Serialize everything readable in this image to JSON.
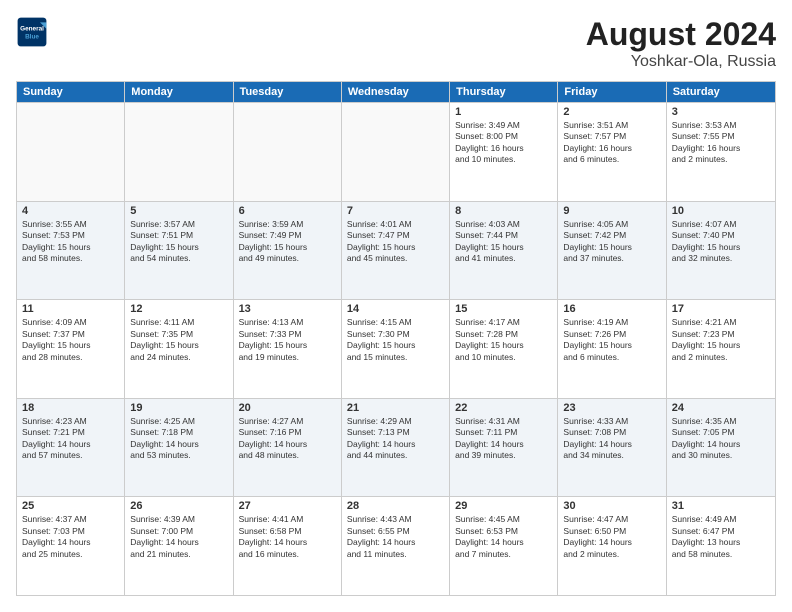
{
  "logo": {
    "line1": "General",
    "line2": "Blue"
  },
  "title": "August 2024",
  "subtitle": "Yoshkar-Ola, Russia",
  "header_days": [
    "Sunday",
    "Monday",
    "Tuesday",
    "Wednesday",
    "Thursday",
    "Friday",
    "Saturday"
  ],
  "rows": [
    [
      {
        "day": "",
        "info": ""
      },
      {
        "day": "",
        "info": ""
      },
      {
        "day": "",
        "info": ""
      },
      {
        "day": "",
        "info": ""
      },
      {
        "day": "1",
        "info": "Sunrise: 3:49 AM\nSunset: 8:00 PM\nDaylight: 16 hours\nand 10 minutes."
      },
      {
        "day": "2",
        "info": "Sunrise: 3:51 AM\nSunset: 7:57 PM\nDaylight: 16 hours\nand 6 minutes."
      },
      {
        "day": "3",
        "info": "Sunrise: 3:53 AM\nSunset: 7:55 PM\nDaylight: 16 hours\nand 2 minutes."
      }
    ],
    [
      {
        "day": "4",
        "info": "Sunrise: 3:55 AM\nSunset: 7:53 PM\nDaylight: 15 hours\nand 58 minutes."
      },
      {
        "day": "5",
        "info": "Sunrise: 3:57 AM\nSunset: 7:51 PM\nDaylight: 15 hours\nand 54 minutes."
      },
      {
        "day": "6",
        "info": "Sunrise: 3:59 AM\nSunset: 7:49 PM\nDaylight: 15 hours\nand 49 minutes."
      },
      {
        "day": "7",
        "info": "Sunrise: 4:01 AM\nSunset: 7:47 PM\nDaylight: 15 hours\nand 45 minutes."
      },
      {
        "day": "8",
        "info": "Sunrise: 4:03 AM\nSunset: 7:44 PM\nDaylight: 15 hours\nand 41 minutes."
      },
      {
        "day": "9",
        "info": "Sunrise: 4:05 AM\nSunset: 7:42 PM\nDaylight: 15 hours\nand 37 minutes."
      },
      {
        "day": "10",
        "info": "Sunrise: 4:07 AM\nSunset: 7:40 PM\nDaylight: 15 hours\nand 32 minutes."
      }
    ],
    [
      {
        "day": "11",
        "info": "Sunrise: 4:09 AM\nSunset: 7:37 PM\nDaylight: 15 hours\nand 28 minutes."
      },
      {
        "day": "12",
        "info": "Sunrise: 4:11 AM\nSunset: 7:35 PM\nDaylight: 15 hours\nand 24 minutes."
      },
      {
        "day": "13",
        "info": "Sunrise: 4:13 AM\nSunset: 7:33 PM\nDaylight: 15 hours\nand 19 minutes."
      },
      {
        "day": "14",
        "info": "Sunrise: 4:15 AM\nSunset: 7:30 PM\nDaylight: 15 hours\nand 15 minutes."
      },
      {
        "day": "15",
        "info": "Sunrise: 4:17 AM\nSunset: 7:28 PM\nDaylight: 15 hours\nand 10 minutes."
      },
      {
        "day": "16",
        "info": "Sunrise: 4:19 AM\nSunset: 7:26 PM\nDaylight: 15 hours\nand 6 minutes."
      },
      {
        "day": "17",
        "info": "Sunrise: 4:21 AM\nSunset: 7:23 PM\nDaylight: 15 hours\nand 2 minutes."
      }
    ],
    [
      {
        "day": "18",
        "info": "Sunrise: 4:23 AM\nSunset: 7:21 PM\nDaylight: 14 hours\nand 57 minutes."
      },
      {
        "day": "19",
        "info": "Sunrise: 4:25 AM\nSunset: 7:18 PM\nDaylight: 14 hours\nand 53 minutes."
      },
      {
        "day": "20",
        "info": "Sunrise: 4:27 AM\nSunset: 7:16 PM\nDaylight: 14 hours\nand 48 minutes."
      },
      {
        "day": "21",
        "info": "Sunrise: 4:29 AM\nSunset: 7:13 PM\nDaylight: 14 hours\nand 44 minutes."
      },
      {
        "day": "22",
        "info": "Sunrise: 4:31 AM\nSunset: 7:11 PM\nDaylight: 14 hours\nand 39 minutes."
      },
      {
        "day": "23",
        "info": "Sunrise: 4:33 AM\nSunset: 7:08 PM\nDaylight: 14 hours\nand 34 minutes."
      },
      {
        "day": "24",
        "info": "Sunrise: 4:35 AM\nSunset: 7:05 PM\nDaylight: 14 hours\nand 30 minutes."
      }
    ],
    [
      {
        "day": "25",
        "info": "Sunrise: 4:37 AM\nSunset: 7:03 PM\nDaylight: 14 hours\nand 25 minutes."
      },
      {
        "day": "26",
        "info": "Sunrise: 4:39 AM\nSunset: 7:00 PM\nDaylight: 14 hours\nand 21 minutes."
      },
      {
        "day": "27",
        "info": "Sunrise: 4:41 AM\nSunset: 6:58 PM\nDaylight: 14 hours\nand 16 minutes."
      },
      {
        "day": "28",
        "info": "Sunrise: 4:43 AM\nSunset: 6:55 PM\nDaylight: 14 hours\nand 11 minutes."
      },
      {
        "day": "29",
        "info": "Sunrise: 4:45 AM\nSunset: 6:53 PM\nDaylight: 14 hours\nand 7 minutes."
      },
      {
        "day": "30",
        "info": "Sunrise: 4:47 AM\nSunset: 6:50 PM\nDaylight: 14 hours\nand 2 minutes."
      },
      {
        "day": "31",
        "info": "Sunrise: 4:49 AM\nSunset: 6:47 PM\nDaylight: 13 hours\nand 58 minutes."
      }
    ]
  ],
  "alt_rows": [
    1,
    3
  ]
}
